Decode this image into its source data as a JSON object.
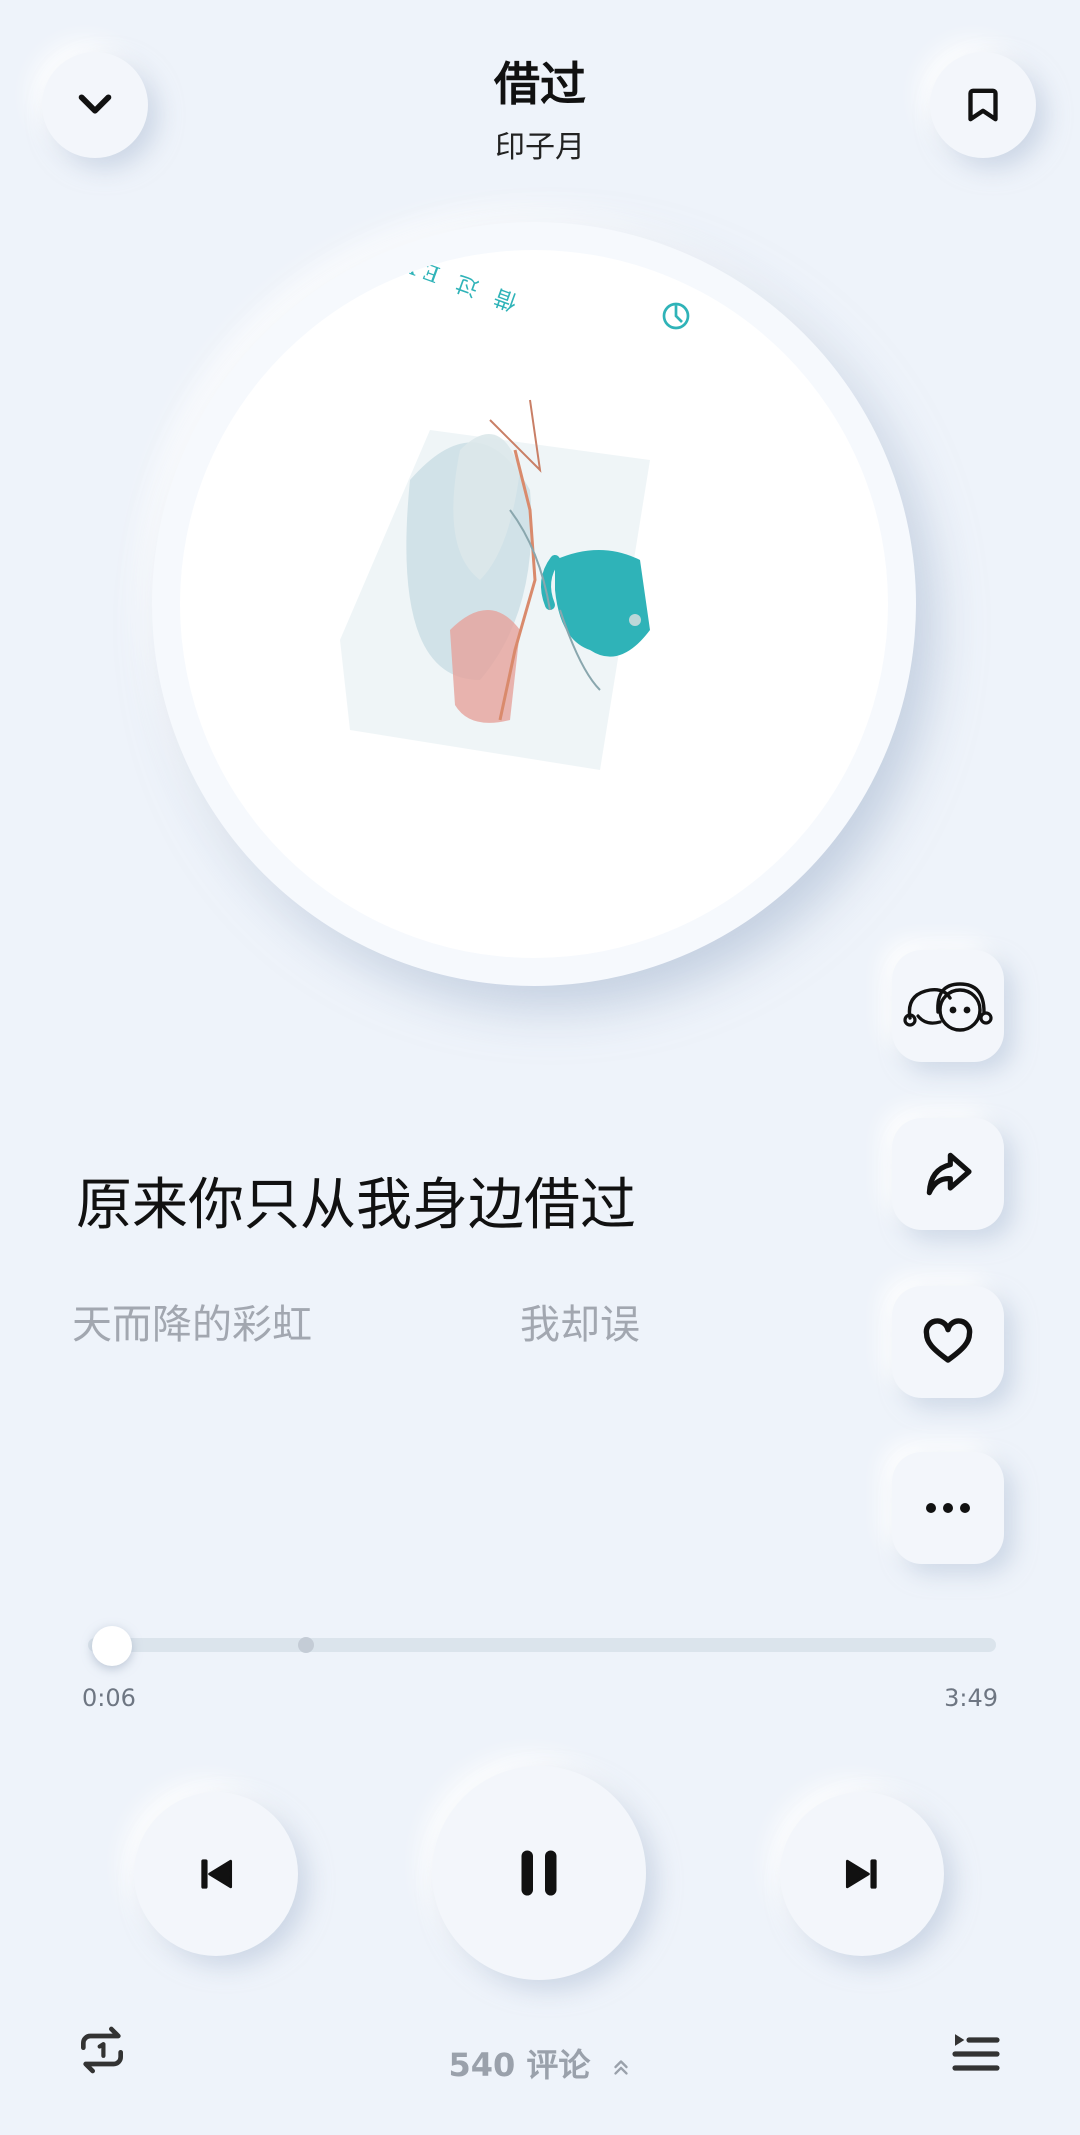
{
  "header": {
    "title": "借过",
    "artist": "印子月"
  },
  "cover": {
    "text": "借 过 EXCUSE"
  },
  "lyrics": {
    "current": "原来你只从我身边借过",
    "next_a": "天而降的彩虹",
    "next_b": "我却误"
  },
  "progress": {
    "elapsed": "0:06",
    "total": "3:49",
    "fraction": 0.026
  },
  "comments": {
    "label": "540 评论"
  },
  "colors": {
    "background": "#eef3fa",
    "button": "#f3f6fb",
    "icon": "#1a1a1a",
    "cover_teal": "#2fb3b8",
    "cover_pink": "#e6a39b",
    "muted_text": "#a2a7b0"
  },
  "icons": {
    "collapse": "chevron-down-icon",
    "bookmark": "bookmark-icon",
    "listen_together": "listen-together-icon",
    "share": "share-icon",
    "like": "heart-icon",
    "more": "more-dots-icon",
    "previous": "skip-previous-icon",
    "pause": "pause-icon",
    "next": "skip-next-icon",
    "repeat": "repeat-one-icon",
    "playlist": "playlist-icon",
    "comments_expand": "chevron-up-double-icon"
  }
}
